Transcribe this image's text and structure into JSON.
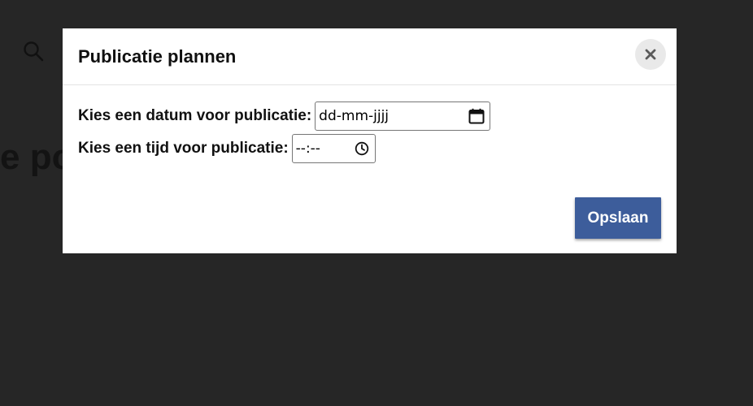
{
  "background": {
    "heading_fragment": "e po",
    "search_icon": "search-icon"
  },
  "dialog": {
    "title": "Publicatie plannen",
    "close_icon": "close-icon",
    "date_field": {
      "label": "Kies een datum voor publicatie:",
      "placeholder": "dd-mm-jjjj",
      "icon": "calendar-icon"
    },
    "time_field": {
      "label": "Kies een tijd voor publicatie:",
      "placeholder": "--:--",
      "icon": "clock-icon"
    },
    "save_label": "Opslaan"
  },
  "colors": {
    "page_background": "#262626",
    "dialog_background": "#ffffff",
    "primary_button": "#3d5d9b",
    "close_button_background": "#e9e9e9"
  }
}
